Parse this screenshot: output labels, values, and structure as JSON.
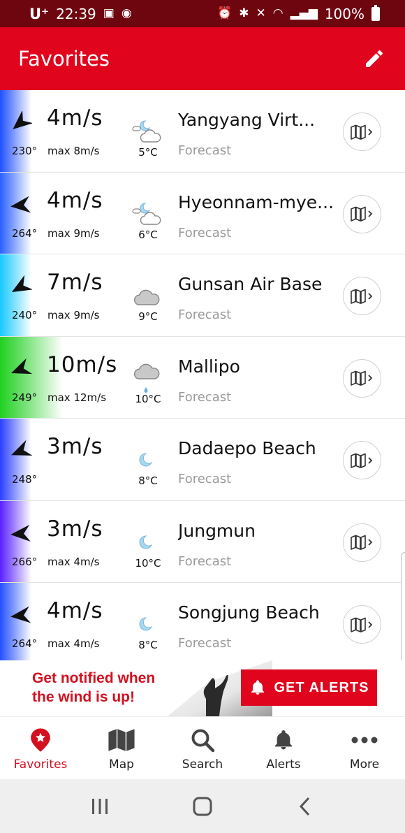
{
  "status_bar": {
    "carrier": "U⁺",
    "time": "22:39",
    "battery": "100%"
  },
  "header": {
    "title": "Favorites"
  },
  "spots": [
    {
      "speed": "4m/s",
      "direction": "230°",
      "max": "max 8m/s",
      "temp": "5°C",
      "name": "Yangyang Virt...",
      "label": "Forecast",
      "icon": "moon-cloud-icon",
      "dir_deg": 230,
      "color": "#2050ff"
    },
    {
      "speed": "4m/s",
      "direction": "264°",
      "max": "max 9m/s",
      "temp": "6°C",
      "name": "Hyeonnam-mye...",
      "label": "Forecast",
      "icon": "moon-cloud-icon",
      "dir_deg": 264,
      "color": "#2a60ff"
    },
    {
      "speed": "7m/s",
      "direction": "240°",
      "max": "max 9m/s",
      "temp": "9°C",
      "name": "Gunsan Air Base",
      "label": "Forecast",
      "icon": "cloud-icon",
      "dir_deg": 240,
      "color": "#18c8ff"
    },
    {
      "speed": "10m/s",
      "direction": "249°",
      "max": "max 12m/s",
      "temp": "10°C",
      "name": "Mallipo",
      "label": "Forecast",
      "icon": "cloud-drizzle-icon",
      "dir_deg": 249,
      "color": "#20d020"
    },
    {
      "speed": "3m/s",
      "direction": "248°",
      "max": "",
      "temp": "8°C",
      "name": "Dadaepo Beach",
      "label": "Forecast",
      "icon": "moon-icon",
      "dir_deg": 248,
      "color": "#2a40ff"
    },
    {
      "speed": "3m/s",
      "direction": "266°",
      "max": "max 4m/s",
      "temp": "10°C",
      "name": "Jungmun",
      "label": "Forecast",
      "icon": "moon-icon",
      "dir_deg": 266,
      "color": "#5a20ff"
    },
    {
      "speed": "4m/s",
      "direction": "264°",
      "max": "max 4m/s",
      "temp": "8°C",
      "name": "Songjung Beach",
      "label": "Forecast",
      "icon": "moon-icon",
      "dir_deg": 264,
      "color": "#2450ff"
    }
  ],
  "banner": {
    "line1": "Get notified when",
    "line2": "the wind is up!",
    "button": "GET ALERTS"
  },
  "nav": [
    {
      "label": "Favorites",
      "icon": "favorite-pin-icon",
      "active": true
    },
    {
      "label": "Map",
      "icon": "map-icon",
      "active": false
    },
    {
      "label": "Search",
      "icon": "search-icon",
      "active": false
    },
    {
      "label": "Alerts",
      "icon": "bell-icon",
      "active": false
    },
    {
      "label": "More",
      "icon": "more-dots-icon",
      "active": false
    }
  ],
  "colors": {
    "brand": "#e0051d",
    "status_bar": "#6e0610",
    "muted": "#9a9a9a"
  }
}
